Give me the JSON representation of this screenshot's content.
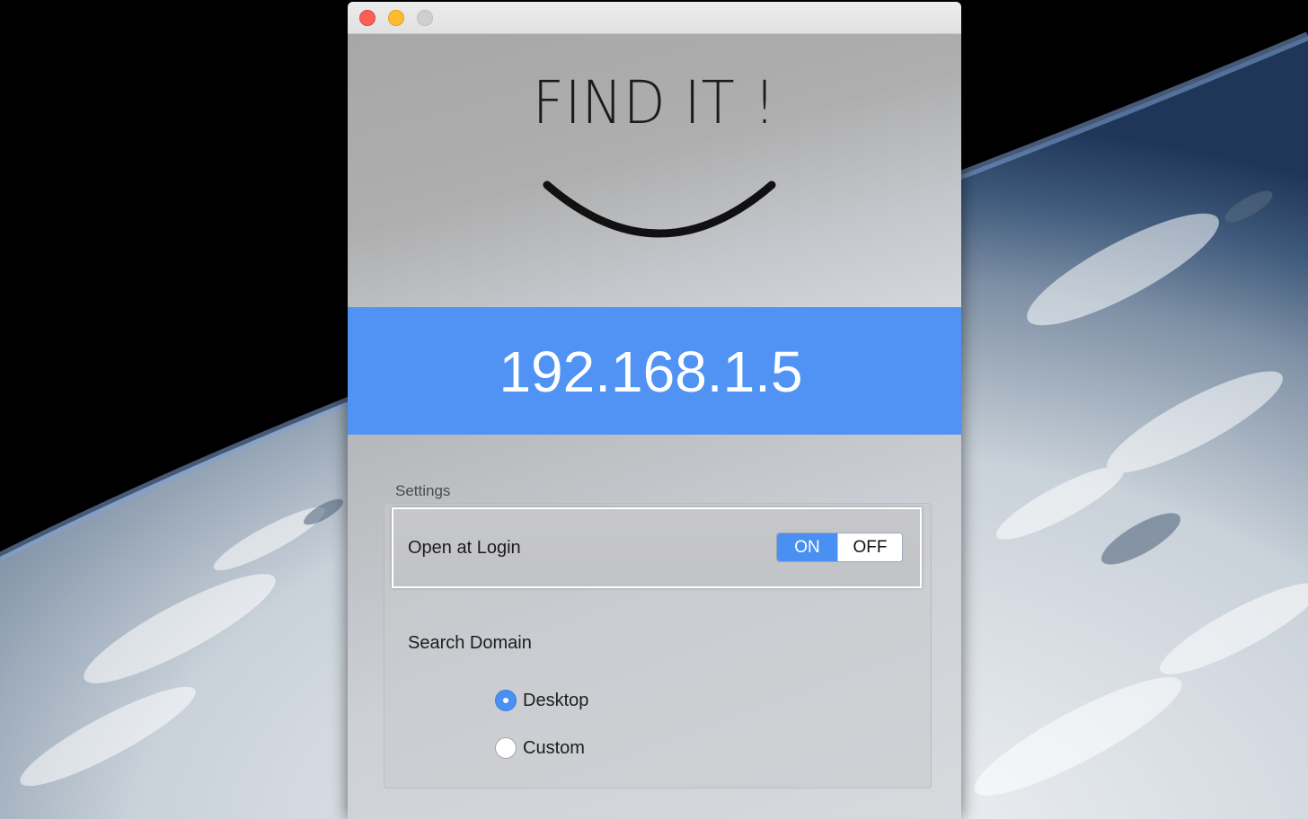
{
  "window": {
    "controls": [
      "close",
      "minimize",
      "zoom"
    ]
  },
  "header": {
    "title": "FIND IT !",
    "logo_icon": "smile-icon"
  },
  "ip": {
    "address": "192.168.1.5",
    "banner_color": "#5193f4"
  },
  "settings": {
    "caption": "Settings",
    "open_at_login": {
      "label": "Open at Login",
      "on_label": "ON",
      "off_label": "OFF",
      "selected": "ON"
    },
    "search_domain": {
      "label": "Search Domain",
      "options": [
        {
          "label": "Desktop",
          "selected": true
        },
        {
          "label": "Custom",
          "selected": false
        }
      ]
    }
  },
  "colors": {
    "accent": "#4a8ff2",
    "close": "#fc5f57",
    "minimize": "#fdbc2e",
    "zoom": "#cfcfcf"
  }
}
